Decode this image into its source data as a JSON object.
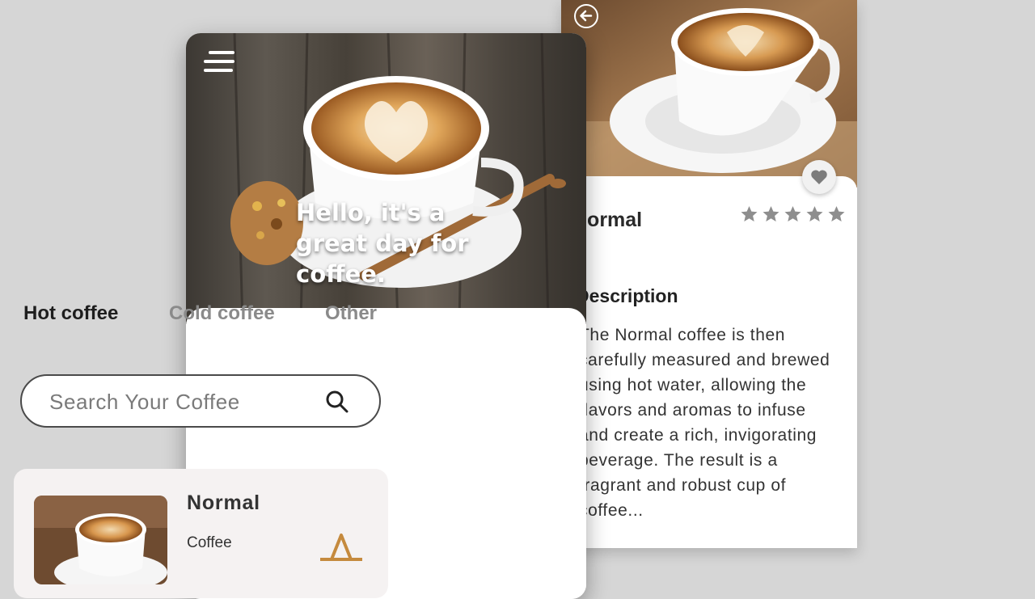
{
  "home": {
    "greeting": "Hello, it's a great day for coffee.",
    "menu_icon": "hamburger-menu-icon",
    "tabs": [
      {
        "label": "Hot coffee",
        "active": true
      },
      {
        "label": "Cold coffee",
        "active": false
      },
      {
        "label": "Other",
        "active": false
      }
    ],
    "search": {
      "placeholder": "Search Your Coffee",
      "value": "",
      "icon": "search-icon"
    },
    "product_card": {
      "title": "Normal",
      "subtitle": "Coffee",
      "icon": "basket-icon"
    }
  },
  "detail": {
    "back_icon": "back-arrow-icon",
    "favorite_icon": "heart-icon",
    "title": "Normal",
    "rating": {
      "value": 5,
      "max": 5
    },
    "description_heading": "Description",
    "description_text": "The Normal coffee is then carefully measured and brewed using hot water, allowing the flavors and aromas to infuse and create a rich, invigorating beverage. The result is a fragrant and robust cup of coffee..."
  },
  "colors": {
    "background": "#d6d6d6",
    "card": "#f5f2f2",
    "accent": "#c58a3e",
    "star": "#8e8e8e"
  }
}
